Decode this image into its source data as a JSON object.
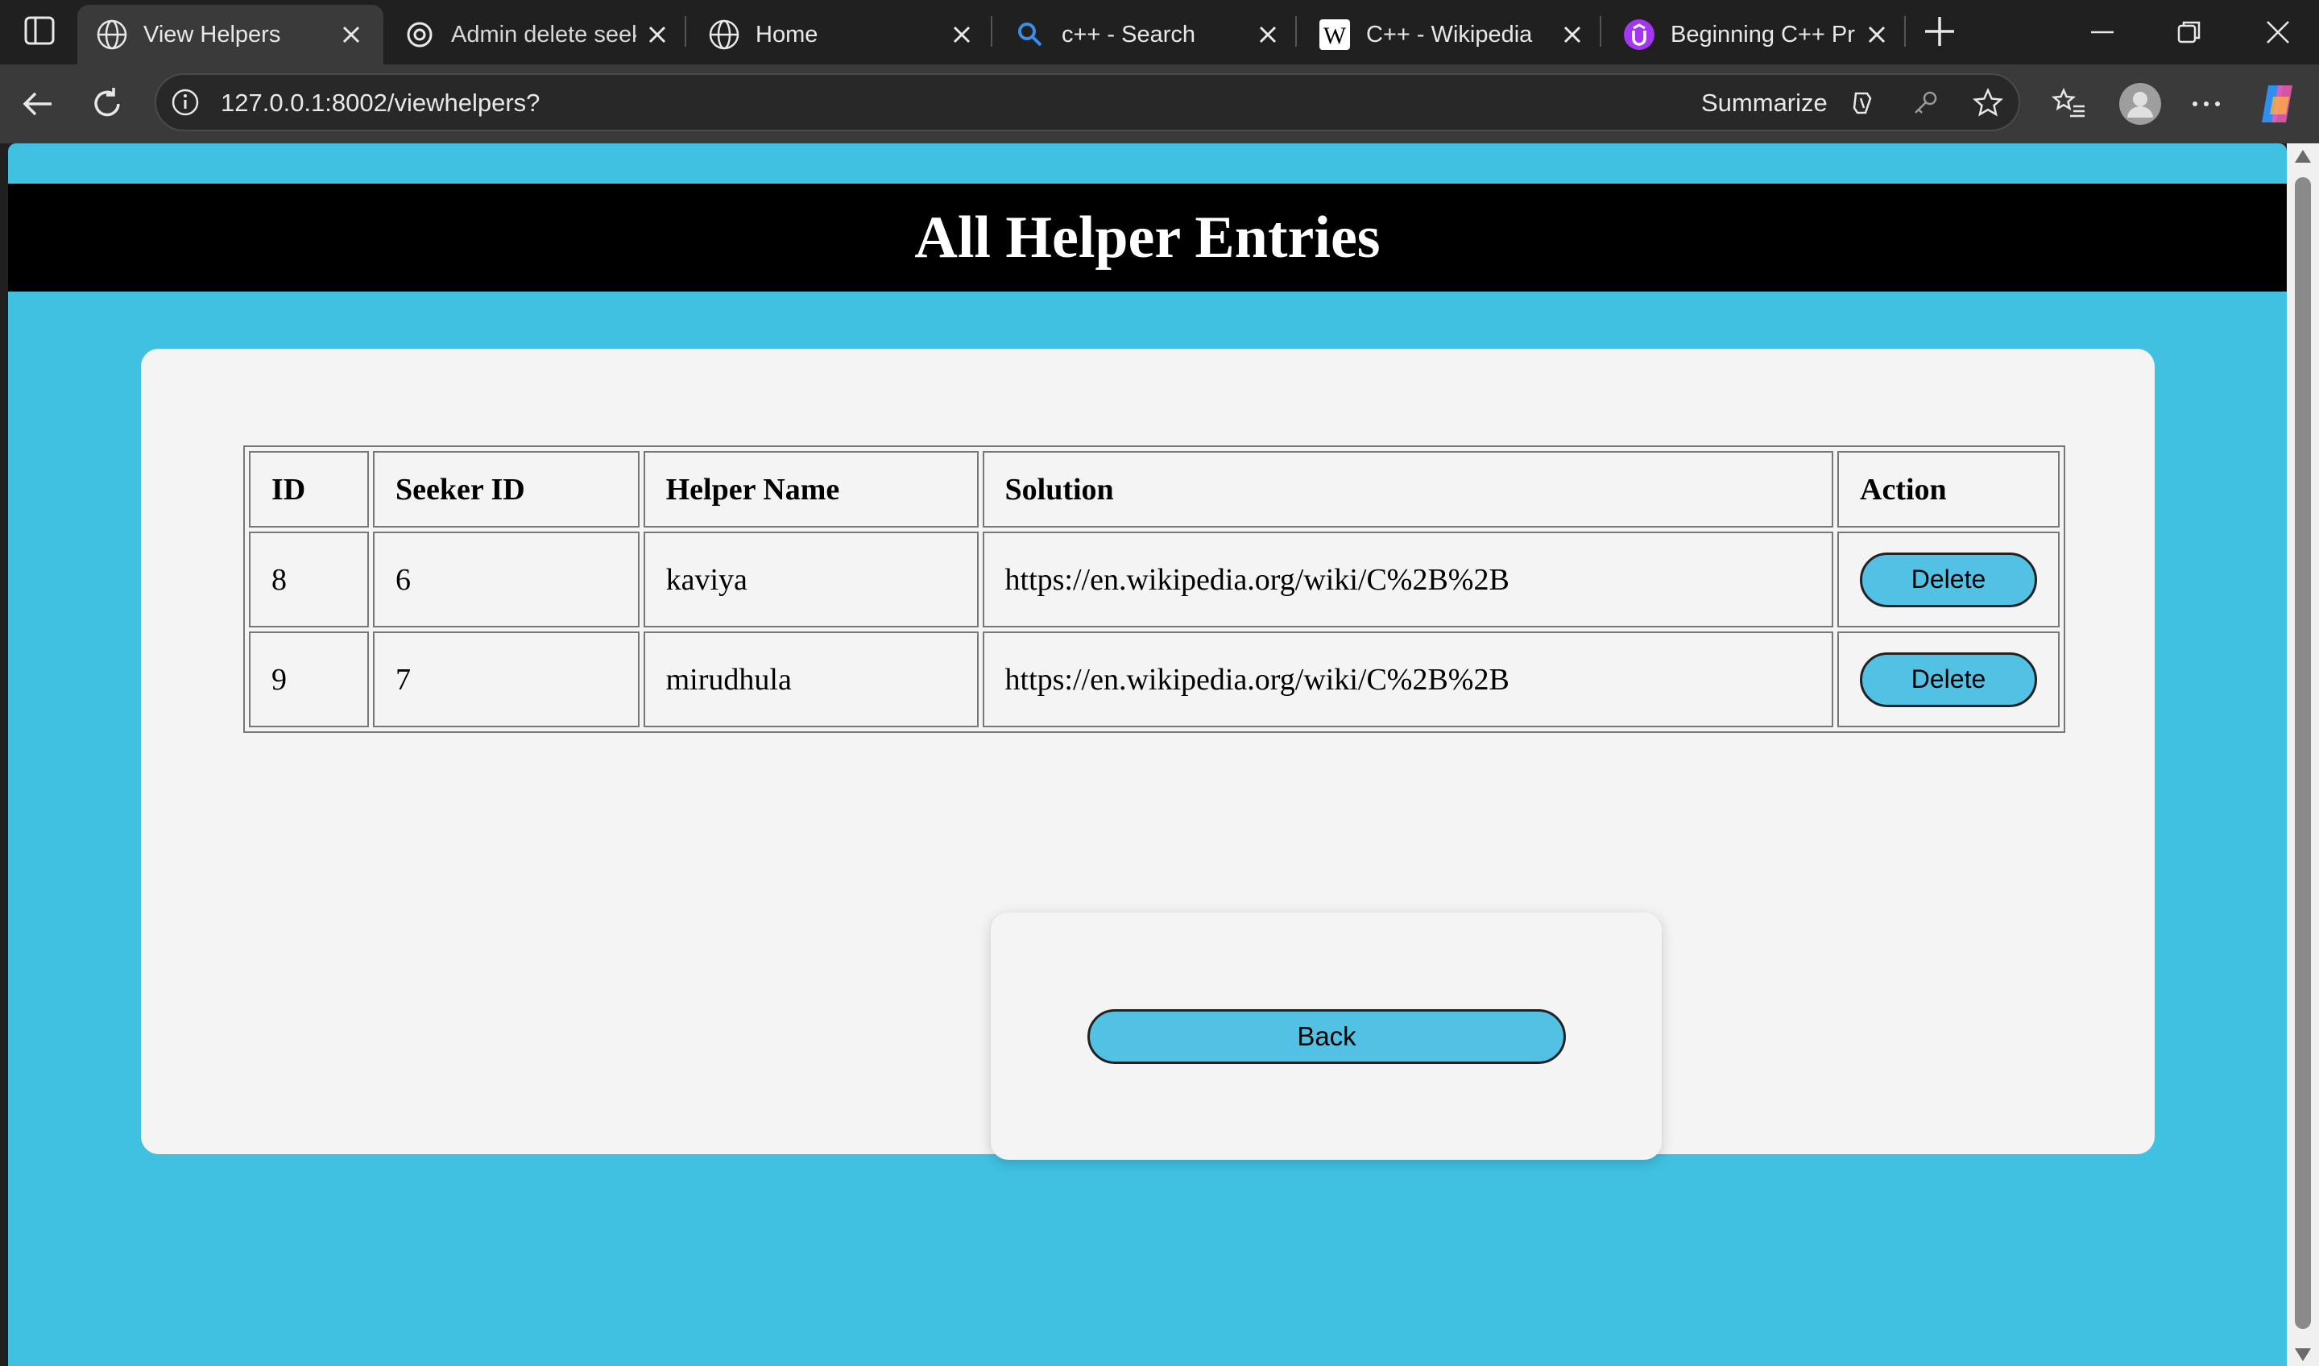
{
  "browser": {
    "tabs": [
      {
        "title": "View Helpers",
        "icon": "globe-icon",
        "active": true
      },
      {
        "title": "Admin delete seek",
        "icon": "chatgpt-icon",
        "active": false
      },
      {
        "title": "Home",
        "icon": "globe-icon",
        "active": false
      },
      {
        "title": "c++ - Search",
        "icon": "search-icon",
        "active": false
      },
      {
        "title": "C++ - Wikipedia",
        "icon": "wikipedia-icon",
        "active": false
      },
      {
        "title": "Beginning C++ Pro",
        "icon": "udemy-icon",
        "active": false
      }
    ],
    "address": "127.0.0.1:8002/viewhelpers?",
    "summarize_label": "Summarize"
  },
  "page": {
    "title": "All Helper Entries",
    "table": {
      "headers": [
        "ID",
        "Seeker ID",
        "Helper Name",
        "Solution",
        "Action"
      ],
      "rows": [
        {
          "id": "8",
          "seeker_id": "6",
          "helper_name": "kaviya",
          "solution": "https://en.wikipedia.org/wiki/C%2B%2B",
          "action": "Delete"
        },
        {
          "id": "9",
          "seeker_id": "7",
          "helper_name": "mirudhula",
          "solution": "https://en.wikipedia.org/wiki/C%2B%2B",
          "action": "Delete"
        }
      ]
    },
    "back_label": "Back"
  },
  "colors": {
    "page_background": "#41c1e2",
    "header_background": "#000000",
    "button_background": "#52c1e3",
    "card_background": "#f4f4f4"
  }
}
